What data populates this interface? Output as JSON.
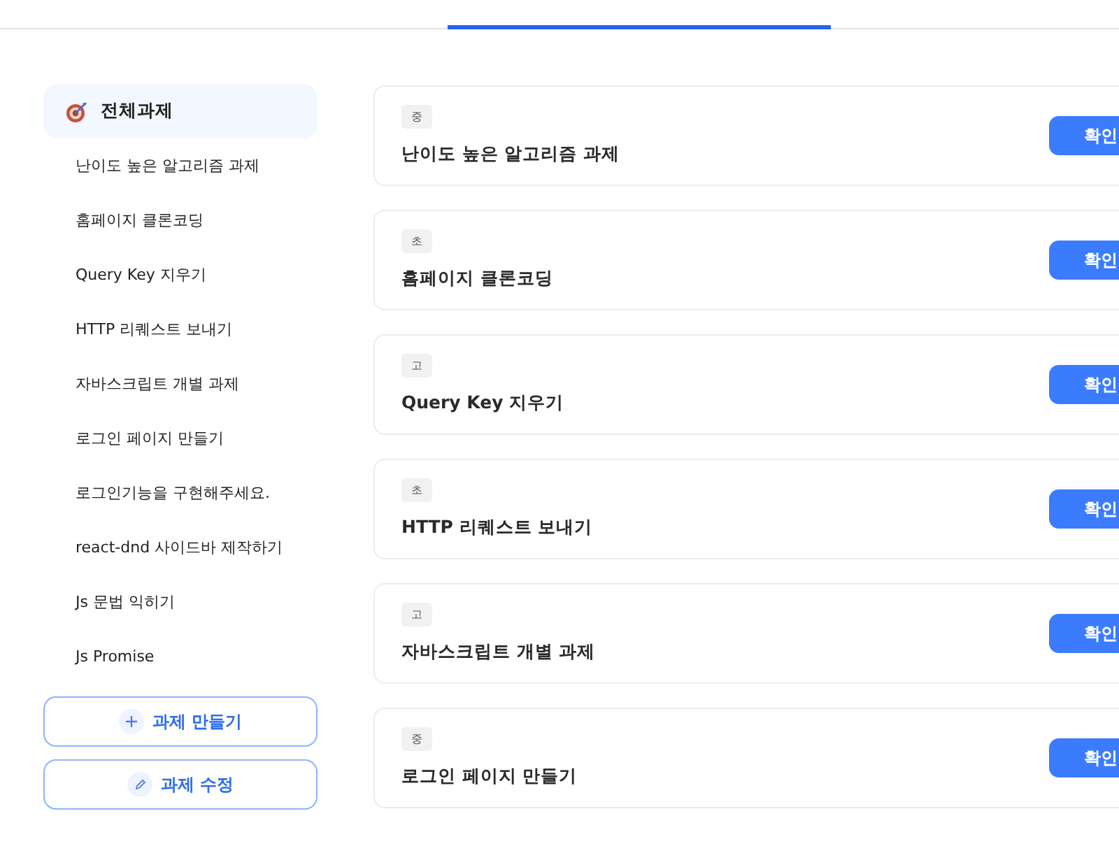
{
  "tabs": [
    {
      "selected": false
    },
    {
      "selected": true
    },
    {
      "selected": false
    }
  ],
  "sidebar": {
    "items": [
      {
        "label": "전체과제",
        "selected": true,
        "kind": "all"
      },
      {
        "label": "난이도 높은 알고리즘 과제",
        "selected": false,
        "kind": "task"
      },
      {
        "label": "홈페이지 클론코딩",
        "selected": false,
        "kind": "task"
      },
      {
        "label": "Query Key 지우기",
        "selected": false,
        "kind": "task"
      },
      {
        "label": "HTTP 리퀘스트 보내기",
        "selected": false,
        "kind": "task"
      },
      {
        "label": "자바스크립트 개별 과제",
        "selected": false,
        "kind": "task"
      },
      {
        "label": "로그인 페이지 만들기",
        "selected": false,
        "kind": "task"
      },
      {
        "label": "로그인기능을 구현해주세요.",
        "selected": false,
        "kind": "task"
      },
      {
        "label": "react-dnd 사이드바 제작하기",
        "selected": false,
        "kind": "task"
      },
      {
        "label": "Js 문법 익히기",
        "selected": false,
        "kind": "task"
      },
      {
        "label": "Js Promise",
        "selected": false,
        "kind": "task"
      }
    ],
    "buttons": [
      {
        "label": "과제 만들기",
        "kind": "create"
      },
      {
        "label": "과제 수정",
        "kind": "edit"
      }
    ]
  },
  "cards": [
    {
      "level": "중",
      "title": "난이도 높은 알고리즘 과제",
      "button": "확인"
    },
    {
      "level": "초",
      "title": "홈페이지 클론코딩",
      "button": "확인"
    },
    {
      "level": "고",
      "title": "Query Key 지우기",
      "button": "확인"
    },
    {
      "level": "초",
      "title": "HTTP 리퀘스트 보내기",
      "button": "확인"
    },
    {
      "level": "고",
      "title": "자바스크립트 개별 과제",
      "button": "확인"
    },
    {
      "level": "중",
      "title": "로그인 페이지 만들기",
      "button": "확인"
    }
  ]
}
